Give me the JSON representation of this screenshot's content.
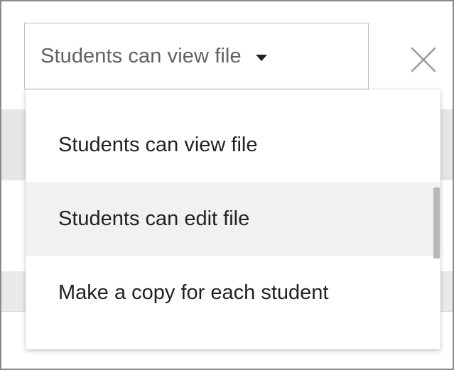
{
  "dropdown": {
    "selected_label": "Students can view file",
    "caret_icon": "caret-down-icon"
  },
  "close": {
    "icon": "close-icon"
  },
  "menu": {
    "items": [
      {
        "label": "Students can view file",
        "highlighted": false
      },
      {
        "label": "Students can edit file",
        "highlighted": true
      },
      {
        "label": "Make a copy for each student",
        "highlighted": false
      }
    ]
  },
  "colors": {
    "text_primary": "#222222",
    "text_secondary": "#5f6368",
    "hover_bg": "#f1f1f1",
    "border": "#bdbdbd"
  }
}
